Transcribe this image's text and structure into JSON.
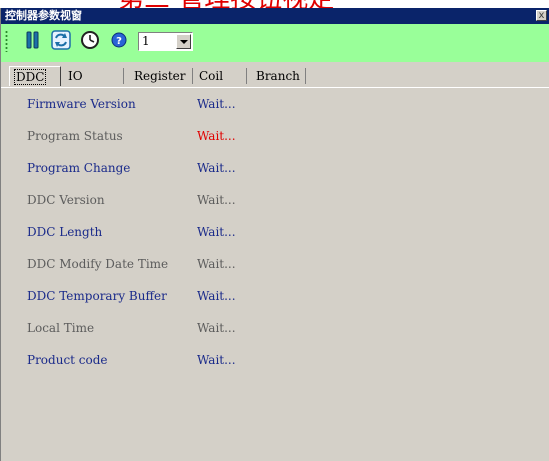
{
  "overlay_caption": "第三 管理按钮视定",
  "window": {
    "title": "控制器参数视窗",
    "close_label": "x"
  },
  "toolbar": {
    "icons": [
      "pause-icon",
      "refresh-icon",
      "clock-icon",
      "help-icon"
    ],
    "combo_value": "1"
  },
  "tabs": [
    {
      "label": "DDC",
      "active": true
    },
    {
      "label": "IO",
      "active": false
    },
    {
      "label": "Register",
      "active": false
    },
    {
      "label": "Coil",
      "active": false
    },
    {
      "label": "Branch",
      "active": false
    }
  ],
  "rows": [
    {
      "label": "Firmware Version",
      "value": "Wait...",
      "label_color": "#1a2a8a",
      "value_color": "#1a2a8a"
    },
    {
      "label": "Program Status",
      "value": "Wait...",
      "label_color": "#5c5c5c",
      "value_color": "#e00000"
    },
    {
      "label": "Program Change",
      "value": "Wait...",
      "label_color": "#1a2a8a",
      "value_color": "#1a2a8a"
    },
    {
      "label": "DDC Version",
      "value": "Wait...",
      "label_color": "#5c5c5c",
      "value_color": "#5c5c5c"
    },
    {
      "label": "DDC Length",
      "value": "Wait...",
      "label_color": "#1a2a8a",
      "value_color": "#1a2a8a"
    },
    {
      "label": "DDC Modify Date Time",
      "value": "Wait...",
      "label_color": "#5c5c5c",
      "value_color": "#5c5c5c"
    },
    {
      "label": "DDC Temporary Buffer",
      "value": "Wait...",
      "label_color": "#1a2a8a",
      "value_color": "#1a2a8a"
    },
    {
      "label": "Local Time",
      "value": "Wait...",
      "label_color": "#5c5c5c",
      "value_color": "#5c5c5c"
    },
    {
      "label": "Product code",
      "value": "Wait...",
      "label_color": "#1a2a8a",
      "value_color": "#1a2a8a"
    }
  ],
  "colors": {
    "titlebar": "#0a246a",
    "toolbar": "#99ff99",
    "panel": "#d4d0c8",
    "accent_red": "#e00000"
  }
}
